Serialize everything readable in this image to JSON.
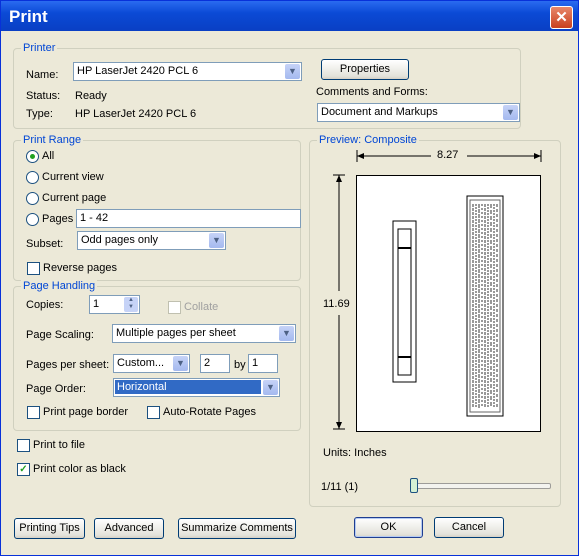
{
  "window": {
    "title": "Print",
    "close": "✕"
  },
  "printer": {
    "legend": "Printer",
    "name_label": "Name:",
    "name_value": "HP LaserJet 2420 PCL 6",
    "status_label": "Status:",
    "status_value": "Ready",
    "type_label": "Type:",
    "type_value": "HP LaserJet 2420 PCL 6",
    "properties_button": "Properties",
    "comments_label": "Comments and Forms:",
    "comments_value": "Document and Markups"
  },
  "print_range": {
    "legend": "Print Range",
    "all": "All",
    "current_view": "Current view",
    "current_page": "Current page",
    "pages": "Pages",
    "pages_value": "1 - 42",
    "subset_label": "Subset:",
    "subset_value": "Odd pages only",
    "reverse_pages": "Reverse pages"
  },
  "page_handling": {
    "legend": "Page Handling",
    "copies_label": "Copies:",
    "copies_value": "1",
    "collate": "Collate",
    "scaling_label": "Page Scaling:",
    "scaling_value": "Multiple pages per sheet",
    "pps_label": "Pages per sheet:",
    "pps_value": "Custom...",
    "pps_x": "2",
    "by_label": "by",
    "pps_y": "1",
    "order_label": "Page Order:",
    "order_value": "Horizontal",
    "print_page_border": "Print page border",
    "auto_rotate": "Auto-Rotate Pages"
  },
  "options": {
    "print_to_file": "Print to file",
    "print_color_as_black": "Print color as black"
  },
  "preview": {
    "legend": "Preview: Composite",
    "width": "8.27",
    "height": "11.69",
    "units": "Units: Inches",
    "page_indicator": "1/11 (1)"
  },
  "buttons": {
    "printing_tips": "Printing Tips",
    "advanced": "Advanced",
    "summarize": "Summarize Comments",
    "ok": "OK",
    "cancel": "Cancel"
  },
  "icons": {
    "close": "close-icon",
    "dropdown": "chevron-down-icon",
    "spinner": "spinner-arrows-icon"
  },
  "colors": {
    "title_bar": "#0b4ad6",
    "legend_text": "#0046d5",
    "selection": "#316ac5",
    "close_button": "#c9401f"
  }
}
